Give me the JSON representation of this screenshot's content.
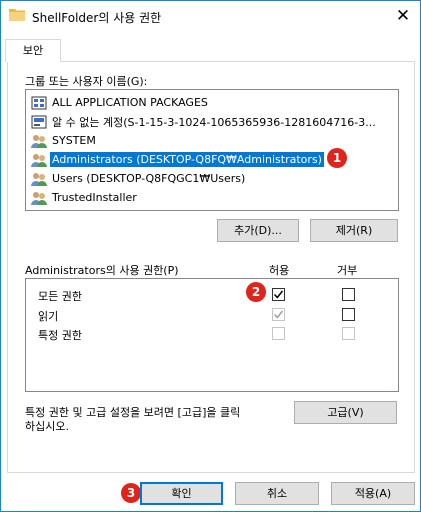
{
  "window": {
    "title": "ShellFolder의 사용 권한",
    "close_glyph": "✕"
  },
  "tab": {
    "label": "보안"
  },
  "groups": {
    "label": "그룹 또는 사용자 이름(G):",
    "items": [
      {
        "label": "ALL APPLICATION PACKAGES",
        "icon": "app-packages-icon"
      },
      {
        "label": "알 수 없는 계정(S-1-15-3-1024-1065365936-1281604716-3...",
        "icon": "unknown-account-icon"
      },
      {
        "label": "SYSTEM",
        "icon": "users-icon"
      },
      {
        "label": "Administrators (DESKTOP-Q8FQ₩Administrators)",
        "icon": "users-icon",
        "selected": true
      },
      {
        "label": "Users (DESKTOP-Q8FQGC1₩Users)",
        "icon": "users-icon"
      },
      {
        "label": "TrustedInstaller",
        "icon": "users-icon"
      }
    ],
    "add_button": "추가(D)...",
    "remove_button": "제거(R)"
  },
  "permissions": {
    "label": "Administrators의 사용 권한(P)",
    "allow_header": "허용",
    "deny_header": "거부",
    "rows": [
      {
        "name": "모든 권한",
        "allow": true,
        "allow_enabled": true,
        "deny": false,
        "deny_enabled": true
      },
      {
        "name": "읽기",
        "allow": true,
        "allow_enabled": false,
        "deny": false,
        "deny_enabled": true
      },
      {
        "name": "특정 권한",
        "allow": false,
        "allow_enabled": false,
        "deny": false,
        "deny_enabled": false
      }
    ]
  },
  "advanced": {
    "text_line1": "특정 권한 및 고급 설정을 보려면 [고급]을 클릭",
    "text_line2": "하십시오.",
    "button": "고급(V)"
  },
  "footer": {
    "ok": "확인",
    "cancel": "취소",
    "apply": "적용(A)"
  },
  "badges": [
    "1",
    "2",
    "3"
  ],
  "colors": {
    "selection": "#0078d7",
    "badge": "#e0231b",
    "border_accent": "#1883d7"
  }
}
